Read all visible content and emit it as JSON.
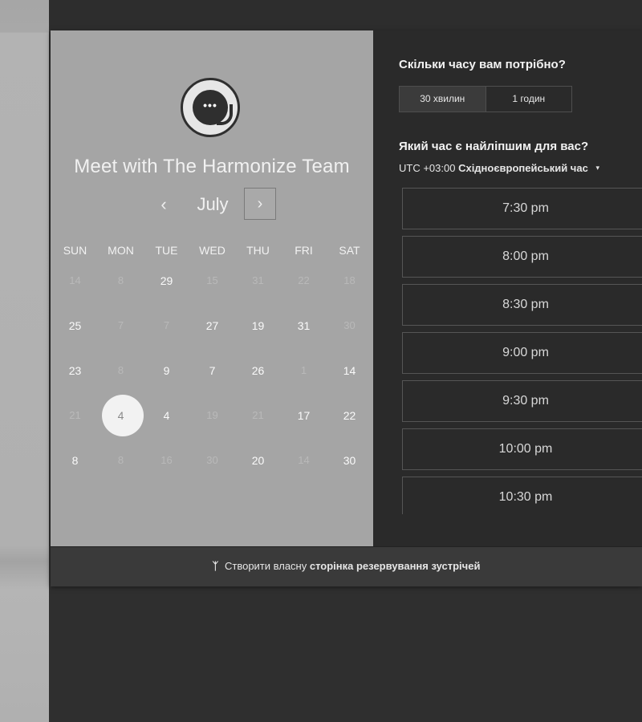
{
  "booking": {
    "title": "Meet with The Harmonize Team",
    "avatar_icon": "chat-bubble-icon",
    "avatar_glyph": "•••",
    "calendar": {
      "month": "July",
      "prev_glyph": "‹",
      "next_glyph": "›",
      "weekdays": [
        "SUN",
        "MON",
        "TUE",
        "WED",
        "THU",
        "FRI",
        "SAT"
      ],
      "weeks": [
        [
          {
            "d": "14",
            "s": "dim"
          },
          {
            "d": "8",
            "s": "dim"
          },
          {
            "d": "29",
            "s": "active"
          },
          {
            "d": "15",
            "s": "dim"
          },
          {
            "d": "31",
            "s": "dim"
          },
          {
            "d": "22",
            "s": "dim"
          },
          {
            "d": "18",
            "s": "dim"
          }
        ],
        [
          {
            "d": "25",
            "s": "active"
          },
          {
            "d": "7",
            "s": "dim"
          },
          {
            "d": "7",
            "s": "dim"
          },
          {
            "d": "27",
            "s": "active"
          },
          {
            "d": "19",
            "s": "active"
          },
          {
            "d": "31",
            "s": "active"
          },
          {
            "d": "30",
            "s": "dim"
          }
        ],
        [
          {
            "d": "23",
            "s": "active"
          },
          {
            "d": "8",
            "s": "dim"
          },
          {
            "d": "9",
            "s": "active"
          },
          {
            "d": "7",
            "s": "active"
          },
          {
            "d": "26",
            "s": "active"
          },
          {
            "d": "1",
            "s": "dim"
          },
          {
            "d": "14",
            "s": "active"
          }
        ],
        [
          {
            "d": "21",
            "s": "dim"
          },
          {
            "d": "4",
            "s": "selected"
          },
          {
            "d": "4",
            "s": "active"
          },
          {
            "d": "19",
            "s": "dim"
          },
          {
            "d": "21",
            "s": "dim"
          },
          {
            "d": "17",
            "s": "active"
          },
          {
            "d": "22",
            "s": "active"
          }
        ],
        [
          {
            "d": "8",
            "s": "active"
          },
          {
            "d": "8",
            "s": "dim"
          },
          {
            "d": "16",
            "s": "dim"
          },
          {
            "d": "30",
            "s": "dim"
          },
          {
            "d": "20",
            "s": "active"
          },
          {
            "d": "14",
            "s": "dim"
          },
          {
            "d": "30",
            "s": "active"
          }
        ]
      ]
    },
    "duration": {
      "question": "Скільки часу вам потрібно?",
      "options": [
        "30 хвилин",
        "1 годин"
      ],
      "selected_index": 0
    },
    "time": {
      "question": "Який час є найліпшим для вас?",
      "tz_offset": "UTC +03:00",
      "tz_name": "Східноєвропейський час",
      "tz_caret": "▾",
      "slots": [
        "7:30 pm",
        "8:00 pm",
        "8:30 pm",
        "9:00 pm",
        "9:30 pm",
        "10:00 pm",
        "10:30 pm"
      ]
    },
    "footer": {
      "logo_glyph": "ᛉ",
      "text": "Створити власну",
      "cta": "сторінка резервування зустрічей"
    }
  },
  "colors": {
    "left_pane": "#a5a5a5",
    "right_pane": "#2a2a2a",
    "selected_day": "#f2f2f2"
  }
}
